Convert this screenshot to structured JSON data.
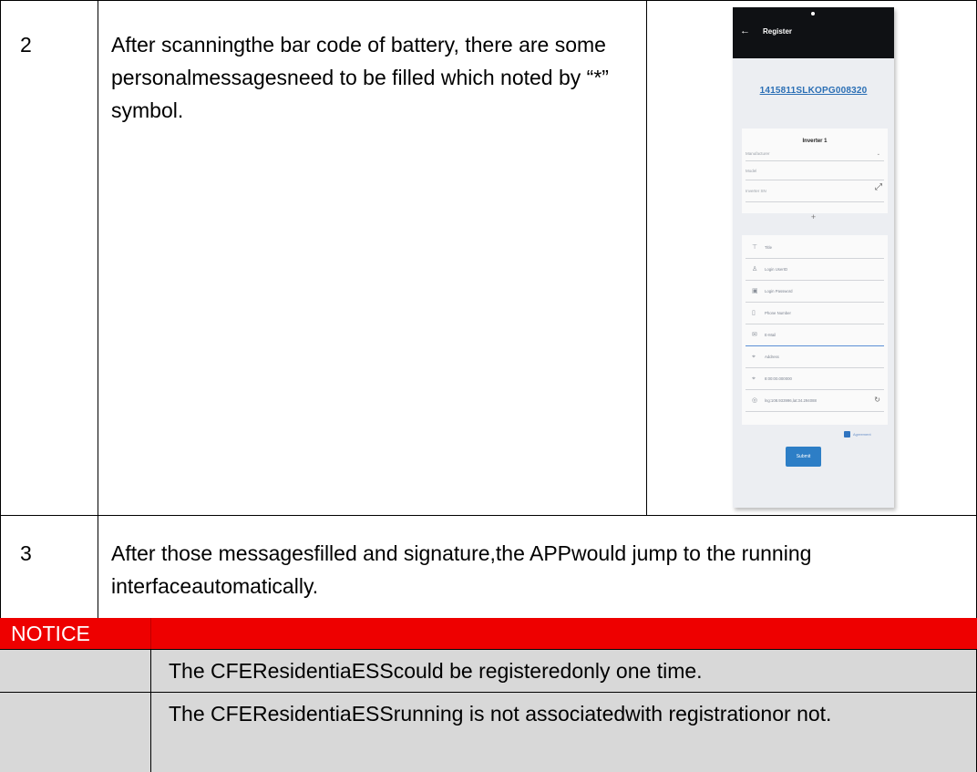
{
  "rows": [
    {
      "num": "2",
      "text": "After scanningthe bar code of battery, there are some personalmessagesneed to be filled which noted by “*” symbol."
    },
    {
      "num": "3",
      "text": "After those messagesfilled and signature,the APPwould jump to the running interfaceautomatically."
    }
  ],
  "notice": {
    "label": "NOTICE",
    "items": [
      "The CFEResidentiaESScould be registeredonly one time.",
      "The CFEResidentiaESSrunning is not associatedwith registrationor not."
    ]
  },
  "phone": {
    "title": "Register",
    "back_icon": "←",
    "code": "1415811SLKOPG008320",
    "inverter_title": "Inverter 1",
    "manufacturer_label": "Manufacturer",
    "model_label": "Model",
    "inverter_sn_label": "Inverter SN",
    "add_label": "+",
    "fields": [
      {
        "icon": "⊤",
        "label": "Title"
      },
      {
        "icon": "♙",
        "label": "Login UserID"
      },
      {
        "icon": "▣",
        "label": "Login Password"
      },
      {
        "icon": "▯",
        "label": "Phone Number"
      },
      {
        "icon": "✉",
        "label": "E-Mail"
      },
      {
        "icon": "⌖",
        "label": "Address"
      },
      {
        "icon": "⌖",
        "label": "8:00:00.000000"
      },
      {
        "icon": "◎",
        "label": "lng:108.933996,lat:34.294088"
      }
    ],
    "agree_label": "Agreement",
    "submit_label": "Submit"
  }
}
